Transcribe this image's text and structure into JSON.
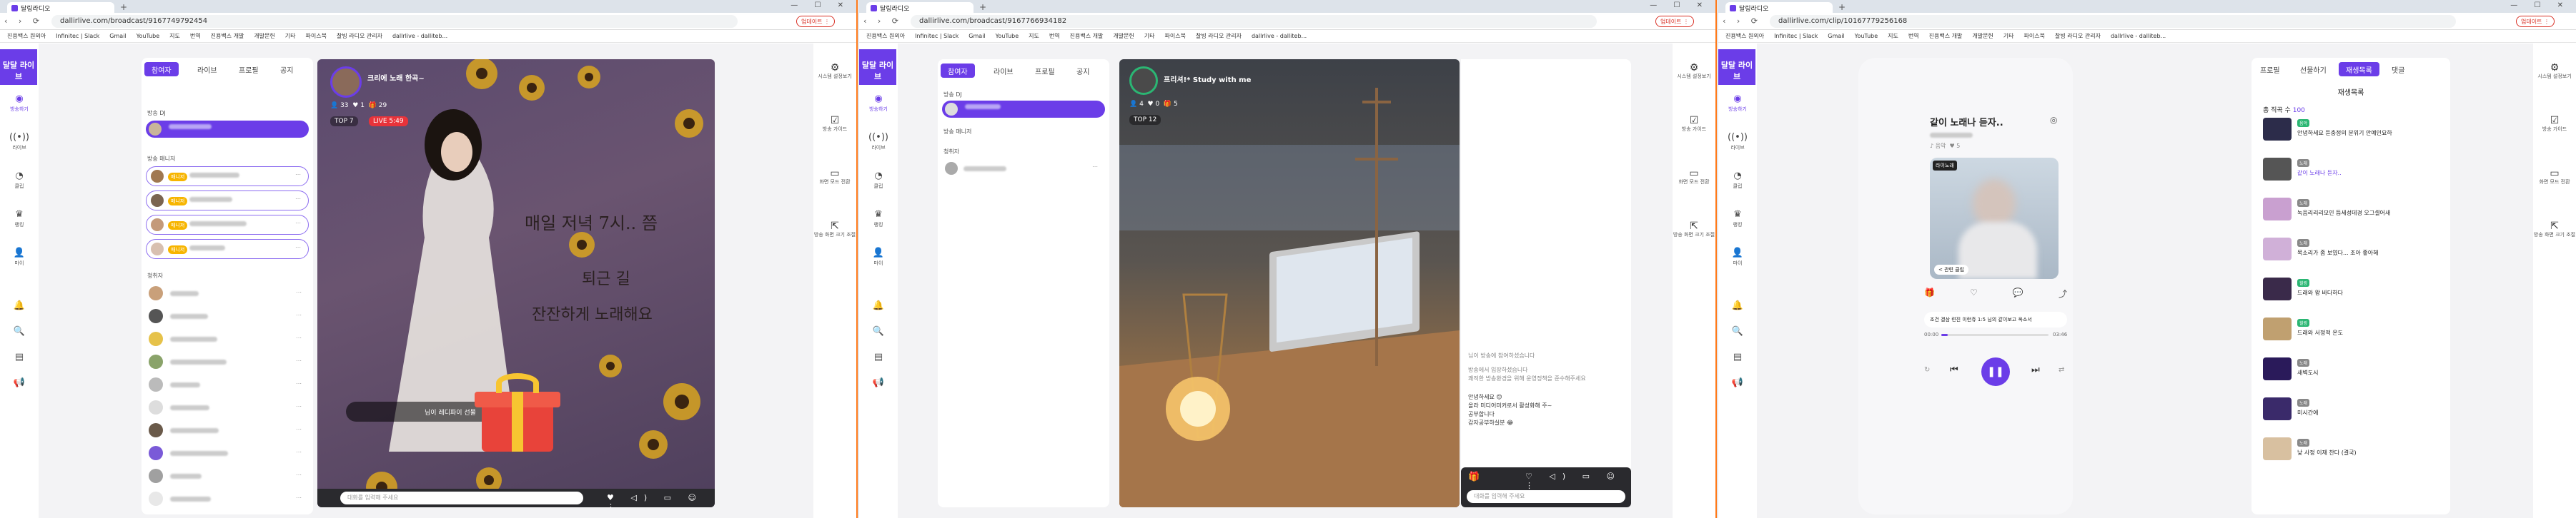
{
  "browser": {
    "tab_title": "달링라디오",
    "new_tab_glyph": "+",
    "window_controls": "— ☐ ✕",
    "nav_glyphs": "‹ › ⟳",
    "update_label": "업데이트 ⋮",
    "bookmarks": [
      "진용백스 원외아",
      "Infinitec | Slack",
      "Gmail",
      "YouTube",
      "지도",
      "번역",
      "진용백스 개발",
      "개발문헌",
      "기타",
      "파이스북",
      "찰빙 라디오 관리자",
      "dallrlive - dalliteb..."
    ]
  },
  "urls": {
    "w1": "dallirlive.com/broadcast/9167749792454",
    "w2": "dallirlive.com/broadcast/9167766934182",
    "w3": "dallirlive.com/clip/10167779256168"
  },
  "leftnav": {
    "logo": "달달 라이브",
    "items": [
      {
        "label": "방송하기",
        "icon": "◉"
      },
      {
        "label": "라이브",
        "icon": "((•))"
      },
      {
        "label": "클립",
        "icon": "◔"
      },
      {
        "label": "랭킹",
        "icon": "♛"
      },
      {
        "label": "마이",
        "icon": "👤"
      }
    ],
    "bottom_icons": [
      "🔔",
      "🔍",
      "▤",
      "📢"
    ]
  },
  "rightnav": {
    "items": [
      {
        "label": "시스템 설정보기",
        "icon": "⚙"
      },
      {
        "label": "방송 가이드",
        "icon": "☑"
      },
      {
        "label": "화면 모드 전환",
        "icon": "▭"
      },
      {
        "label": "방송 화면 크기 조절",
        "icon": "⇱"
      }
    ]
  },
  "w1": {
    "tabs": [
      "참여자",
      "라이브",
      "프로필",
      "공지"
    ],
    "host_section": "방송 DJ",
    "manager_section": "방송 매니저",
    "listener_section": "청취자",
    "manager_badge": "매니저",
    "broadcast_title": "크리에 노래 한곡~",
    "stats": [
      "33",
      "1",
      "29"
    ],
    "top_label": "TOP 7",
    "live_badge": "LIVE 5:49",
    "overlay_text_1": "매일 저녁 7시.. 쯤",
    "overlay_text_2": "퇴근 길",
    "overlay_text_3": "잔잔하게 노래해요",
    "gift_popup": "님이 레디파이 선물",
    "chat_placeholder": "대화를 입력해 주세요",
    "chat_controls": "♥ ◁) ▭ ☺ ⋮"
  },
  "w2": {
    "tabs": [
      "참여자",
      "라이브",
      "프로필",
      "공지"
    ],
    "host_section": "방송 DJ",
    "manager_section": "방송 매니저",
    "listener_section": "청취자",
    "broadcast_title": "프리셔!* Study with me",
    "stats": [
      "4",
      "0",
      "5"
    ],
    "top_label": "TOP 12",
    "chat_notice": "님이 방송에 참여하셨습니다",
    "chat_lines": [
      "방송에서 입장하셨습니다",
      "쾌적한 방송환경을 위해 운영정책을 준수해주세요",
      "안녕하세요 😊",
      "올라 미디어미커로서 활성화해 주~",
      "공부합니다",
      "감자공부하실분 😂"
    ],
    "chat_placeholder": "대화를 입력해 주세요",
    "chat_controls": "♡ ◁) ▭ ☺ ⋮"
  },
  "w3": {
    "tabs": [
      "프로필",
      "선물하기",
      "재생목록",
      "댓글"
    ],
    "playlist_title": "재생목록",
    "clip_title": "같이 노래나 듣자..",
    "clip_meta": [
      "음악",
      "5"
    ],
    "album_tag": "라이노래",
    "album_footer": "< 관련 클립",
    "actions": [
      "🎁",
      "♡",
      "💬",
      "⤴"
    ],
    "now_playing": "조건 결삼 련진 이런쥬 1:5 님의 같이보고 옥소서",
    "time_start": "00:00",
    "time_end": "03:46",
    "progress": 0.06,
    "total_label": "총 직곡 수",
    "total_count": "100",
    "songs": [
      {
        "title": "안녕하세요 듣충정의 분위기 안예인요하",
        "tag": "음악",
        "tag_color": "#2bb673"
      },
      {
        "title": "같이 노래나 듣자..",
        "tag": "노래",
        "tag_color": "#888",
        "active": true
      },
      {
        "title": "녹음리리리모인 듬세성데경 오그셀어새",
        "tag": "노래",
        "tag_color": "#888"
      },
      {
        "title": "목소리가 좀 보였다... 조아 좋아해",
        "tag": "노래",
        "tag_color": "#888"
      },
      {
        "title": "드래와 왕 바다하다",
        "tag": "힐링",
        "tag_color": "#2bb673"
      },
      {
        "title": "드래와 서정적 온도",
        "tag": "힐링",
        "tag_color": "#2bb673"
      },
      {
        "title": "새벽도시",
        "tag": "노래",
        "tag_color": "#888"
      },
      {
        "title": "미시간애",
        "tag": "노래",
        "tag_color": "#888"
      },
      {
        "title": "낮 사정 이재 찬다 (결국)",
        "tag": "노래",
        "tag_color": "#888"
      }
    ]
  },
  "colors": {
    "accent": "#6b3de8",
    "update": "#d93025",
    "border": "#ff7a1a"
  }
}
